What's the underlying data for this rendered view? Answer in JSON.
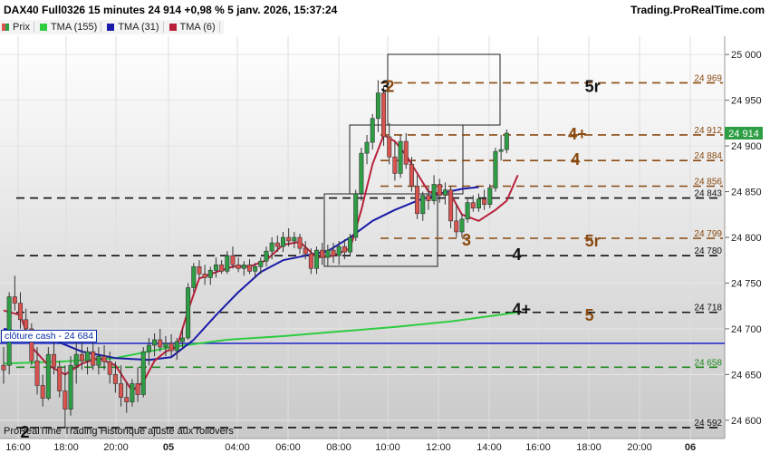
{
  "header": {
    "instrument": "DAX40 Full0326 15 minutes 24 914 +0,98 % 5 janv. 2026, 15:37:24",
    "brand": "Trading.ProRealTime.com"
  },
  "legend": [
    {
      "label": "Prix",
      "color": "#d9534f"
    },
    {
      "label": "TMA (155)",
      "color": "#2ecc40"
    },
    {
      "label": "TMA (31)",
      "color": "#1a1aa8"
    },
    {
      "label": "TMA (6)",
      "color": "#b8203a"
    }
  ],
  "footer": {
    "credit": "ProRealTime Trading  Historique ajusté aux rollovers",
    "cash_label": "clôture cash -  24 684"
  },
  "chart_data": {
    "type": "candlestick",
    "timeframe": "15 minutes",
    "ylim": [
      24580,
      25020
    ],
    "x_ticks": [
      "16:00",
      "18:00",
      "20:00",
      "05",
      "04:00",
      "06:00",
      "08:00",
      "10:00",
      "12:00",
      "14:00",
      "16:00",
      "18:00",
      "20:00",
      "06"
    ],
    "y_ticks": [
      24600,
      24650,
      24700,
      24750,
      24800,
      24850,
      24900,
      24950,
      25000
    ],
    "y_tick_labels": [
      "24 600",
      "24 650",
      "24 700",
      "24 750",
      "24 800",
      "24 850",
      "24 900",
      "24 950",
      "25 000"
    ],
    "last_price": {
      "value": 24914,
      "label": "24 914"
    },
    "cash_close": 24684,
    "candles": [
      {
        "o": 24660,
        "h": 24680,
        "l": 24640,
        "c": 24655
      },
      {
        "o": 24660,
        "h": 24740,
        "l": 24650,
        "c": 24735
      },
      {
        "o": 24735,
        "h": 24758,
        "l": 24720,
        "c": 24728
      },
      {
        "o": 24728,
        "h": 24740,
        "l": 24700,
        "c": 24710
      },
      {
        "o": 24710,
        "h": 24722,
        "l": 24690,
        "c": 24700
      },
      {
        "o": 24700,
        "h": 24706,
        "l": 24660,
        "c": 24665
      },
      {
        "o": 24665,
        "h": 24680,
        "l": 24628,
        "c": 24638
      },
      {
        "o": 24638,
        "h": 24650,
        "l": 24615,
        "c": 24624
      },
      {
        "o": 24624,
        "h": 24680,
        "l": 24622,
        "c": 24672
      },
      {
        "o": 24672,
        "h": 24688,
        "l": 24650,
        "c": 24658
      },
      {
        "o": 24658,
        "h": 24665,
        "l": 24625,
        "c": 24632
      },
      {
        "o": 24632,
        "h": 24660,
        "l": 24592,
        "c": 24612
      },
      {
        "o": 24612,
        "h": 24670,
        "l": 24605,
        "c": 24660
      },
      {
        "o": 24660,
        "h": 24685,
        "l": 24640,
        "c": 24672
      },
      {
        "o": 24672,
        "h": 24690,
        "l": 24655,
        "c": 24665
      },
      {
        "o": 24665,
        "h": 24680,
        "l": 24650,
        "c": 24675
      },
      {
        "o": 24675,
        "h": 24685,
        "l": 24655,
        "c": 24660
      },
      {
        "o": 24660,
        "h": 24680,
        "l": 24650,
        "c": 24670
      },
      {
        "o": 24670,
        "h": 24682,
        "l": 24655,
        "c": 24664
      },
      {
        "o": 24664,
        "h": 24675,
        "l": 24640,
        "c": 24650
      },
      {
        "o": 24650,
        "h": 24664,
        "l": 24630,
        "c": 24640
      },
      {
        "o": 24640,
        "h": 24660,
        "l": 24615,
        "c": 24625
      },
      {
        "o": 24625,
        "h": 24642,
        "l": 24608,
        "c": 24620
      },
      {
        "o": 24620,
        "h": 24645,
        "l": 24615,
        "c": 24640
      },
      {
        "o": 24640,
        "h": 24658,
        "l": 24620,
        "c": 24628
      },
      {
        "o": 24628,
        "h": 24680,
        "l": 24625,
        "c": 24675
      },
      {
        "o": 24675,
        "h": 24690,
        "l": 24660,
        "c": 24682
      },
      {
        "o": 24682,
        "h": 24695,
        "l": 24670,
        "c": 24688
      },
      {
        "o": 24688,
        "h": 24700,
        "l": 24675,
        "c": 24680
      },
      {
        "o": 24680,
        "h": 24692,
        "l": 24670,
        "c": 24684
      },
      {
        "o": 24684,
        "h": 24694,
        "l": 24670,
        "c": 24676
      },
      {
        "o": 24676,
        "h": 24690,
        "l": 24666,
        "c": 24686
      },
      {
        "o": 24686,
        "h": 24700,
        "l": 24678,
        "c": 24690
      },
      {
        "o": 24690,
        "h": 24750,
        "l": 24688,
        "c": 24745
      },
      {
        "o": 24745,
        "h": 24772,
        "l": 24740,
        "c": 24768
      },
      {
        "o": 24768,
        "h": 24775,
        "l": 24755,
        "c": 24760
      },
      {
        "o": 24760,
        "h": 24770,
        "l": 24748,
        "c": 24756
      },
      {
        "o": 24756,
        "h": 24768,
        "l": 24748,
        "c": 24764
      },
      {
        "o": 24764,
        "h": 24778,
        "l": 24756,
        "c": 24770
      },
      {
        "o": 24770,
        "h": 24775,
        "l": 24760,
        "c": 24763
      },
      {
        "o": 24763,
        "h": 24785,
        "l": 24760,
        "c": 24780
      },
      {
        "o": 24780,
        "h": 24790,
        "l": 24766,
        "c": 24770
      },
      {
        "o": 24770,
        "h": 24778,
        "l": 24762,
        "c": 24766
      },
      {
        "o": 24766,
        "h": 24774,
        "l": 24758,
        "c": 24770
      },
      {
        "o": 24770,
        "h": 24776,
        "l": 24760,
        "c": 24763
      },
      {
        "o": 24763,
        "h": 24772,
        "l": 24756,
        "c": 24768
      },
      {
        "o": 24768,
        "h": 24778,
        "l": 24760,
        "c": 24774
      },
      {
        "o": 24774,
        "h": 24790,
        "l": 24768,
        "c": 24785
      },
      {
        "o": 24785,
        "h": 24800,
        "l": 24776,
        "c": 24794
      },
      {
        "o": 24794,
        "h": 24802,
        "l": 24784,
        "c": 24790
      },
      {
        "o": 24790,
        "h": 24806,
        "l": 24784,
        "c": 24800
      },
      {
        "o": 24800,
        "h": 24810,
        "l": 24790,
        "c": 24796
      },
      {
        "o": 24796,
        "h": 24806,
        "l": 24788,
        "c": 24800
      },
      {
        "o": 24800,
        "h": 24804,
        "l": 24782,
        "c": 24788
      },
      {
        "o": 24788,
        "h": 24796,
        "l": 24776,
        "c": 24782
      },
      {
        "o": 24782,
        "h": 24788,
        "l": 24760,
        "c": 24766
      },
      {
        "o": 24766,
        "h": 24790,
        "l": 24760,
        "c": 24786
      },
      {
        "o": 24786,
        "h": 24794,
        "l": 24770,
        "c": 24778
      },
      {
        "o": 24778,
        "h": 24792,
        "l": 24768,
        "c": 24786
      },
      {
        "o": 24786,
        "h": 24794,
        "l": 24772,
        "c": 24780
      },
      {
        "o": 24780,
        "h": 24796,
        "l": 24770,
        "c": 24790
      },
      {
        "o": 24790,
        "h": 24798,
        "l": 24776,
        "c": 24784
      },
      {
        "o": 24784,
        "h": 24804,
        "l": 24780,
        "c": 24800
      },
      {
        "o": 24800,
        "h": 24852,
        "l": 24796,
        "c": 24848
      },
      {
        "o": 24848,
        "h": 24898,
        "l": 24840,
        "c": 24892
      },
      {
        "o": 24892,
        "h": 24912,
        "l": 24880,
        "c": 24904
      },
      {
        "o": 24904,
        "h": 24935,
        "l": 24896,
        "c": 24930
      },
      {
        "o": 24930,
        "h": 24972,
        "l": 24915,
        "c": 24958
      },
      {
        "o": 24958,
        "h": 24966,
        "l": 24900,
        "c": 24910
      },
      {
        "o": 24910,
        "h": 24925,
        "l": 24880,
        "c": 24888
      },
      {
        "o": 24888,
        "h": 24905,
        "l": 24862,
        "c": 24870
      },
      {
        "o": 24870,
        "h": 24912,
        "l": 24865,
        "c": 24905
      },
      {
        "o": 24905,
        "h": 24914,
        "l": 24875,
        "c": 24880
      },
      {
        "o": 24880,
        "h": 24888,
        "l": 24850,
        "c": 24856
      },
      {
        "o": 24856,
        "h": 24868,
        "l": 24820,
        "c": 24826
      },
      {
        "o": 24826,
        "h": 24850,
        "l": 24818,
        "c": 24846
      },
      {
        "o": 24846,
        "h": 24855,
        "l": 24830,
        "c": 24840
      },
      {
        "o": 24840,
        "h": 24868,
        "l": 24836,
        "c": 24858
      },
      {
        "o": 24858,
        "h": 24864,
        "l": 24838,
        "c": 24846
      },
      {
        "o": 24846,
        "h": 24860,
        "l": 24836,
        "c": 24852
      },
      {
        "o": 24852,
        "h": 24856,
        "l": 24810,
        "c": 24818
      },
      {
        "o": 24818,
        "h": 24836,
        "l": 24800,
        "c": 24806
      },
      {
        "o": 24806,
        "h": 24826,
        "l": 24800,
        "c": 24820
      },
      {
        "o": 24820,
        "h": 24842,
        "l": 24816,
        "c": 24838
      },
      {
        "o": 24838,
        "h": 24846,
        "l": 24828,
        "c": 24832
      },
      {
        "o": 24832,
        "h": 24848,
        "l": 24828,
        "c": 24842
      },
      {
        "o": 24842,
        "h": 24852,
        "l": 24830,
        "c": 24836
      },
      {
        "o": 24836,
        "h": 24858,
        "l": 24832,
        "c": 24854
      },
      {
        "o": 24854,
        "h": 24898,
        "l": 24850,
        "c": 24894
      },
      {
        "o": 24894,
        "h": 24912,
        "l": 24884,
        "c": 24896
      },
      {
        "o": 24896,
        "h": 24918,
        "l": 24892,
        "c": 24914
      }
    ],
    "series": [
      {
        "name": "TMA (155)",
        "color": "#2ecc40",
        "width": 2,
        "points": [
          [
            0,
            24662
          ],
          [
            10,
            24664
          ],
          [
            20,
            24668
          ],
          [
            30,
            24680
          ],
          [
            40,
            24688
          ],
          [
            50,
            24692
          ],
          [
            60,
            24697
          ],
          [
            70,
            24702
          ],
          [
            80,
            24708
          ],
          [
            92,
            24718
          ]
        ]
      },
      {
        "name": "TMA (31)",
        "color": "#1a1aa8",
        "width": 2,
        "points": [
          [
            0,
            24700
          ],
          [
            8,
            24690
          ],
          [
            14,
            24675
          ],
          [
            20,
            24668
          ],
          [
            26,
            24666
          ],
          [
            30,
            24669
          ],
          [
            34,
            24688
          ],
          [
            38,
            24715
          ],
          [
            42,
            24740
          ],
          [
            46,
            24762
          ],
          [
            50,
            24775
          ],
          [
            54,
            24780
          ],
          [
            58,
            24785
          ],
          [
            62,
            24800
          ],
          [
            66,
            24818
          ],
          [
            70,
            24830
          ],
          [
            74,
            24840
          ],
          [
            78,
            24848
          ],
          [
            82,
            24853
          ],
          [
            85,
            24855
          ]
        ]
      },
      {
        "name": "TMA (6)",
        "color": "#b8203a",
        "width": 2,
        "points": [
          [
            0,
            24720
          ],
          [
            3,
            24715
          ],
          [
            5,
            24680
          ],
          [
            8,
            24660
          ],
          [
            11,
            24650
          ],
          [
            14,
            24662
          ],
          [
            17,
            24668
          ],
          [
            20,
            24660
          ],
          [
            23,
            24632
          ],
          [
            25,
            24642
          ],
          [
            27,
            24665
          ],
          [
            29,
            24675
          ],
          [
            31,
            24680
          ],
          [
            33,
            24720
          ],
          [
            35,
            24755
          ],
          [
            38,
            24762
          ],
          [
            41,
            24768
          ],
          [
            44,
            24768
          ],
          [
            47,
            24775
          ],
          [
            50,
            24792
          ],
          [
            53,
            24795
          ],
          [
            56,
            24778
          ],
          [
            59,
            24780
          ],
          [
            62,
            24788
          ],
          [
            64,
            24830
          ],
          [
            66,
            24880
          ],
          [
            68,
            24912
          ],
          [
            70,
            24905
          ],
          [
            72,
            24890
          ],
          [
            74,
            24870
          ],
          [
            76,
            24850
          ],
          [
            78,
            24848
          ],
          [
            80,
            24847
          ],
          [
            82,
            24825
          ],
          [
            85,
            24818
          ],
          [
            88,
            24830
          ],
          [
            90,
            24840
          ],
          [
            92,
            24868
          ]
        ]
      }
    ],
    "levels": [
      {
        "value": 24969,
        "label": "24 969",
        "color": "#8a4a10",
        "style": "dash",
        "tag": "5r"
      },
      {
        "value": 24912,
        "label": "24 912",
        "color": "#8a4a10",
        "style": "dash",
        "tag": "4+"
      },
      {
        "value": 24884,
        "label": "24 884",
        "color": "#8a4a10",
        "style": "dash",
        "tag": "4"
      },
      {
        "value": 24856,
        "label": "24 856",
        "color": "#8a4a10",
        "style": "dash"
      },
      {
        "value": 24843,
        "label": "24 843",
        "color": "#111111",
        "style": "dash"
      },
      {
        "value": 24799,
        "label": "24 799",
        "color": "#8a4a10",
        "style": "dash",
        "tag": "5r"
      },
      {
        "value": 24780,
        "label": "24 780",
        "color": "#111111",
        "style": "dash",
        "tag": "4"
      },
      {
        "value": 24718,
        "label": "24 718",
        "color": "#111111",
        "style": "dash",
        "tag": "4+"
      },
      {
        "value": 24658,
        "label": "24 658",
        "color": "#1e8a1e",
        "style": "dash"
      },
      {
        "value": 24592,
        "label": "24 592",
        "color": "#111111",
        "style": "dash"
      }
    ],
    "annotations": [
      {
        "text": "3",
        "x": 67.5,
        "y": 24966,
        "color": "#111111"
      },
      {
        "text": "2",
        "x": 68.3,
        "y": 24966,
        "color": "#8a4a10"
      },
      {
        "text": "5r",
        "x": 104,
        "y": 24966,
        "color": "#111111"
      },
      {
        "text": "4+",
        "x": 101,
        "y": 24914,
        "color": "#8a4a10"
      },
      {
        "text": "4",
        "x": 101.5,
        "y": 24886,
        "color": "#8a4a10"
      },
      {
        "text": "3",
        "x": 82,
        "y": 24798,
        "color": "#8a4a10"
      },
      {
        "text": "5r",
        "x": 104,
        "y": 24797,
        "color": "#8a4a10"
      },
      {
        "text": "4",
        "x": 91,
        "y": 24782,
        "color": "#111111"
      },
      {
        "text": "4+",
        "x": 91,
        "y": 24722,
        "color": "#111111"
      },
      {
        "text": "5",
        "x": 104,
        "y": 24716,
        "color": "#8a4a10"
      },
      {
        "text": "2",
        "x": 3,
        "y": 24588,
        "color": "#111111"
      }
    ],
    "grid": true
  }
}
